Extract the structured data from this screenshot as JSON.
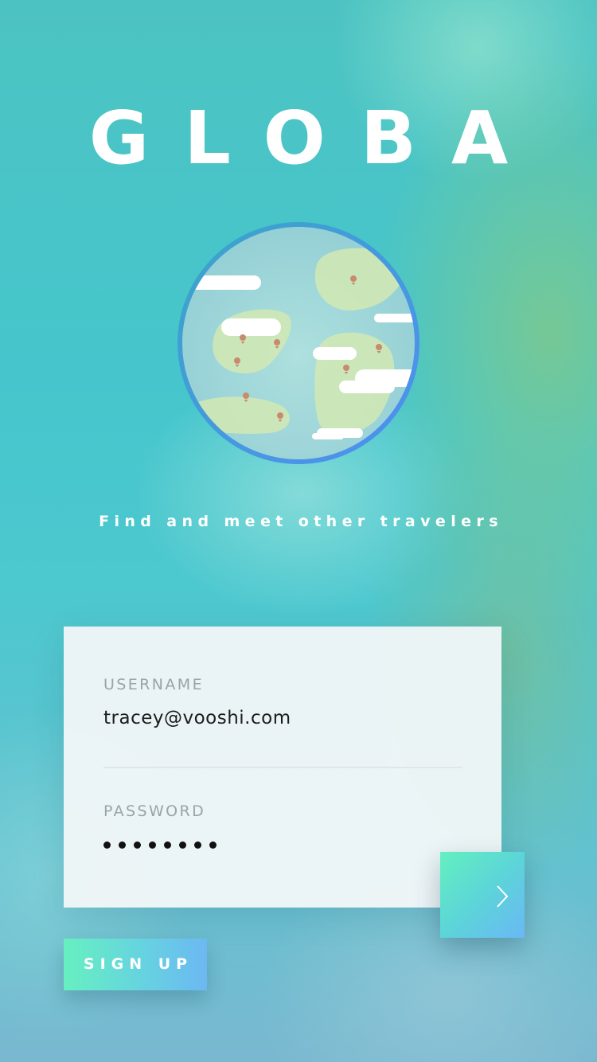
{
  "app": {
    "title": "GLOBA",
    "tagline": "Find and meet other travelers"
  },
  "login": {
    "username_label": "USERNAME",
    "username_value": "tracey@vooshi.com",
    "password_label": "PASSWORD",
    "password_mask": "••••••••",
    "password_length": 8
  },
  "actions": {
    "submit_icon": "chevron-right-icon",
    "signup_label": "SIGN UP"
  },
  "colors": {
    "accent_start": "#63f0bf",
    "accent_end": "#6ab8f5",
    "text_primary": "#1c1c1c",
    "label_gray": "#9aa3a6"
  }
}
